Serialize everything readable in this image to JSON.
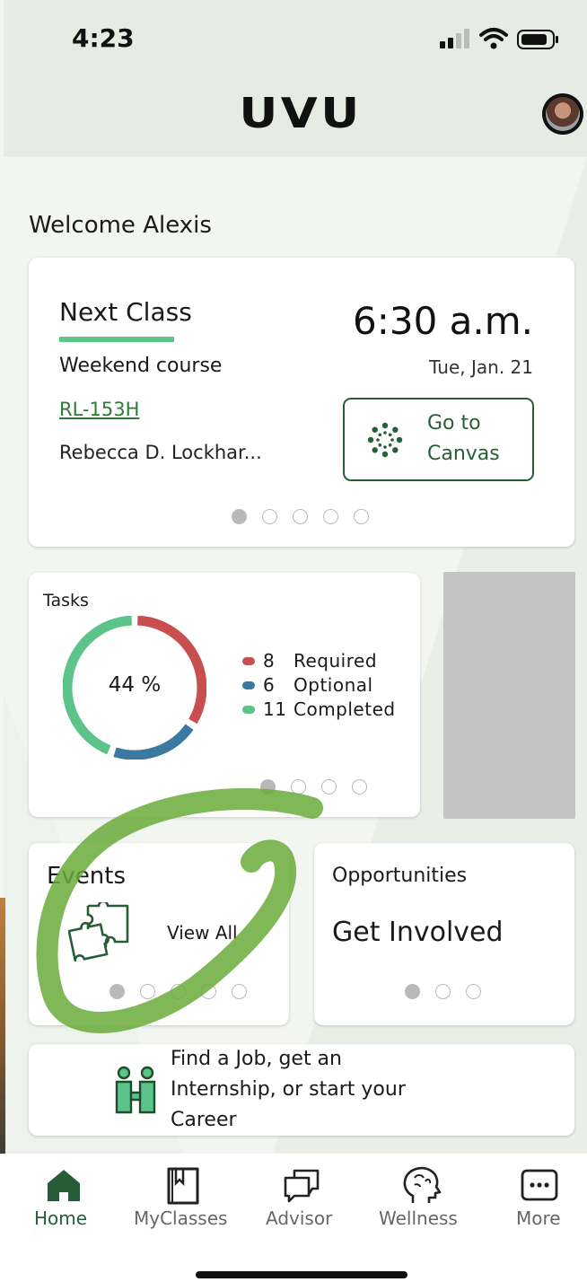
{
  "status_bar": {
    "time": "4:23"
  },
  "header": {
    "logo": "UVU"
  },
  "welcome": "Welcome Alexis",
  "next_class": {
    "title": "Next Class",
    "time": "6:30 a.m.",
    "course_name": "Weekend course",
    "date": "Tue, Jan. 21",
    "room": "RL-153H",
    "instructor": "Rebecca D. Lockhar...",
    "canvas_button": "Go to Canvas",
    "canvas_line1": "Go to",
    "canvas_line2": "Canvas"
  },
  "tasks": {
    "title": "Tasks",
    "percent_text": "44 %",
    "legend": [
      {
        "count": "8",
        "label": "Required",
        "color": "#c94f4f"
      },
      {
        "count": "6",
        "label": "Optional",
        "color": "#3a7aa0"
      },
      {
        "count": "11",
        "label": "Completed",
        "color": "#5cc48a"
      }
    ]
  },
  "events": {
    "title": "Events",
    "view_all": "View All"
  },
  "opportunities": {
    "title": "Opportunities",
    "headline": "Get Involved"
  },
  "career": {
    "line1": "Find a Job, get an",
    "line2": "Internship, or start your",
    "line3": "Career"
  },
  "nav": [
    {
      "label": "Home",
      "icon": "home-icon",
      "active": true
    },
    {
      "label": "MyClasses",
      "icon": "book-icon"
    },
    {
      "label": "Advisor",
      "icon": "chat-icon"
    },
    {
      "label": "Wellness",
      "icon": "brain-icon"
    },
    {
      "label": "More",
      "icon": "more-icon"
    }
  ],
  "colors": {
    "brand": "#275d38",
    "accent": "#5cc48a",
    "required": "#c94f4f",
    "optional": "#3a7aa0"
  }
}
